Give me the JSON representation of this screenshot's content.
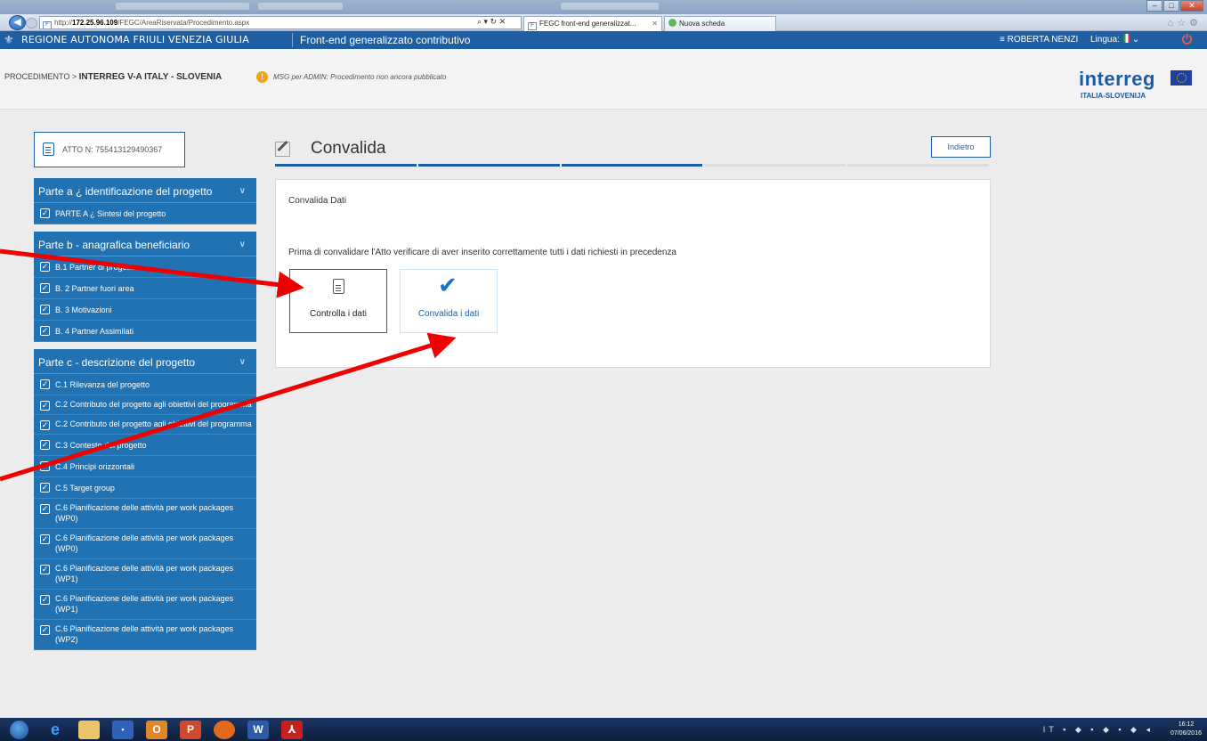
{
  "browser": {
    "address_scheme": "http://",
    "address_host": "172.25.96.109",
    "address_path": "/FEGC/AreaRiservata/Procedimento.aspx",
    "address_tools": "⌕ ▾ ↻ ✕",
    "tabs": [
      {
        "label": "FEGC front-end generalizzat..."
      },
      {
        "label": "Nuova scheda"
      }
    ]
  },
  "header": {
    "region": "REGIONE AUTONOMA FRIULI VENEZIA GIULIA",
    "app_name": "Front-end generalizzato contributivo",
    "user": "≡ ROBERTA NENZI",
    "language_label": "Lingua:"
  },
  "breadcrumb": {
    "prefix": "PROCEDIMENTO >",
    "current": "INTERREG V-A ITALY - SLOVENIA",
    "admin_msg": "MSG per ADMIN: Procedimento non ancora pubblicato"
  },
  "logo": {
    "word": "interreg",
    "sub": "ITALIA-SLOVENIJA"
  },
  "atto": {
    "label": "ATTO N: 755413129490367"
  },
  "sidebar": {
    "sections": [
      {
        "title": "Parte a ¿ identificazione del progetto",
        "items": [
          "PARTE A ¿ Sintesi del progetto"
        ]
      },
      {
        "title": "Parte b - anagrafica beneficiario",
        "items": [
          "B.1 Partner di progetto",
          "B. 2 Partner fuori area",
          "B. 3 Motivazioni",
          "B. 4 Partner Assimilati"
        ]
      },
      {
        "title": "Parte c - descrizione del progetto",
        "items": [
          "C.1 Rilevanza del progetto",
          "C.2 Contributo del progetto agli obiettivi del programma",
          "C.2 Contributo del progetto agli obiettivi del programma",
          "C.3 Contesto del progetto",
          "C.4 Principi orizzontali",
          "C.5 Target group",
          "C.6 Pianificazione delle attività per work packages (WP0)",
          "C.6 Pianificazione delle attività per work packages (WP0)",
          "C.6 Pianificazione delle attività per work packages (WP1)",
          "C.6 Pianificazione delle attività per work packages (WP1)",
          "C.6 Pianificazione delle attività per work packages (WP2)"
        ]
      }
    ]
  },
  "main": {
    "title": "Convalida",
    "back_button": "Indietro",
    "steps_active": 3,
    "steps_total": 5,
    "panel_title": "Convalida Dati",
    "panel_message": "Prima di convalidare l'Atto verificare di aver inserito correttamente tutti i dati richiesti in precedenza",
    "actions": [
      {
        "label": "Controlla i dati",
        "icon": "document-icon"
      },
      {
        "label": "Convalida i dati",
        "icon": "checkmark-icon"
      }
    ]
  },
  "taskbar": {
    "tray_lang": "IT",
    "time": "16:12",
    "date": "07/06/2016"
  },
  "colors": {
    "header_blue": "#1e5fa3",
    "sidebar_blue": "#2072b3",
    "annotation_red": "#ee0000"
  }
}
